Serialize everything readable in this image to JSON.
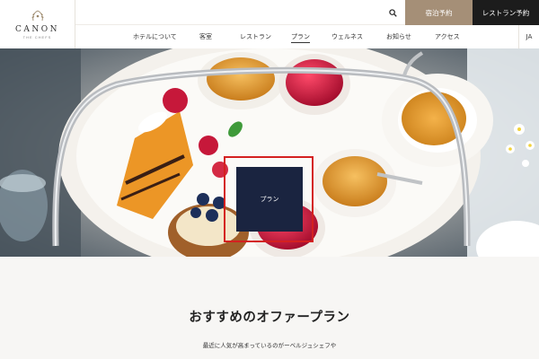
{
  "brand": {
    "name": "CANON",
    "tagline": "THE CHEFS"
  },
  "header": {
    "search_icon": "search-icon",
    "hotel_booking_label": "宿泊予約",
    "restaurant_booking_label": "レストラン予約"
  },
  "nav": {
    "items": [
      "ホテルについて",
      "客室",
      "レストラン",
      "プラン",
      "ウェルネス",
      "お知らせ",
      "アクセス"
    ],
    "active": "プラン",
    "language": "JA"
  },
  "hero": {
    "card_label": "プラン"
  },
  "section": {
    "title": "おすすめのオファープラン",
    "description": "最近に人気が高まっているのがーベルジュシェフや"
  },
  "colors": {
    "hotel_button": "#a58f77",
    "restaurant_button": "#1c1c1c",
    "plan_card": "#1a2440",
    "highlight": "#d42020"
  }
}
